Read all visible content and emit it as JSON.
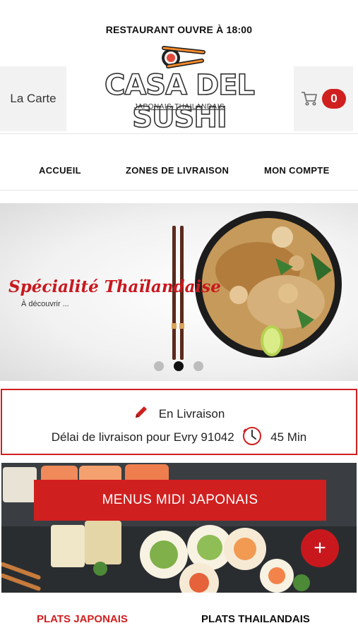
{
  "header": {
    "notice": "RESTAURANT OUVRE À 18:00",
    "menu_button": "La Carte",
    "cart_count": "0",
    "logo_title": "CASA DEL SUSHI",
    "logo_subtitle": "JAPONAIS-THAILANDAIS"
  },
  "nav": {
    "items": [
      {
        "label": "ACCUEIL"
      },
      {
        "label": "ZONES DE LIVRAISON"
      },
      {
        "label": "MON COMPTE"
      }
    ]
  },
  "banner": {
    "title": "Spécialité Thaïlandaise",
    "subtitle": "À découvrir ...",
    "slide_count": 3,
    "active_slide": 2
  },
  "delivery": {
    "mode": "En Livraison",
    "text": "Délai de livraison pour Evry 91042",
    "time": "45 Min"
  },
  "promo": {
    "label": "MENUS MIDI JAPONAIS",
    "plus": "+"
  },
  "tabs": [
    {
      "label": "PLATS JAPONAIS",
      "active": true
    },
    {
      "label": "PLATS THAILANDAIS",
      "active": false
    }
  ],
  "colors": {
    "accent": "#d01f1f",
    "text": "#111111",
    "panel": "#f2f2f2"
  }
}
